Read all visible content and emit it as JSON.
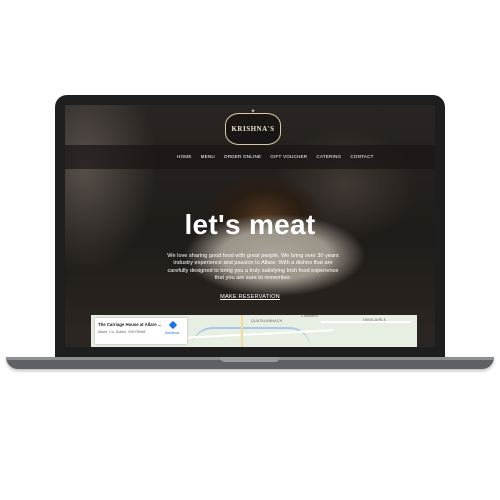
{
  "header": {
    "logo_text": "KRISHNA'S",
    "nav": [
      "HOME",
      "MENU",
      "ORDER ONLINE",
      "GIFT VOUCHER",
      "CATERING",
      "CONTACT"
    ]
  },
  "hero": {
    "headline": "let's meat",
    "tagline": "We love sharing good food with great people. We bring over 30 years industry experience and passion to Allare. With a dishes that are carefully designed to bring you a truly satisfying Irish food experience that you are sure to remember.",
    "cta_label": "MAKE RESERVATION"
  },
  "map": {
    "place_title": "The Carriage House at Allare ...",
    "place_address": "Allare, Co. Dublin, V99 R6W8",
    "directions_label": "Directions",
    "labels": [
      "QUATALANNACH",
      "Clonkeen",
      "NEWCAIRLE"
    ]
  }
}
